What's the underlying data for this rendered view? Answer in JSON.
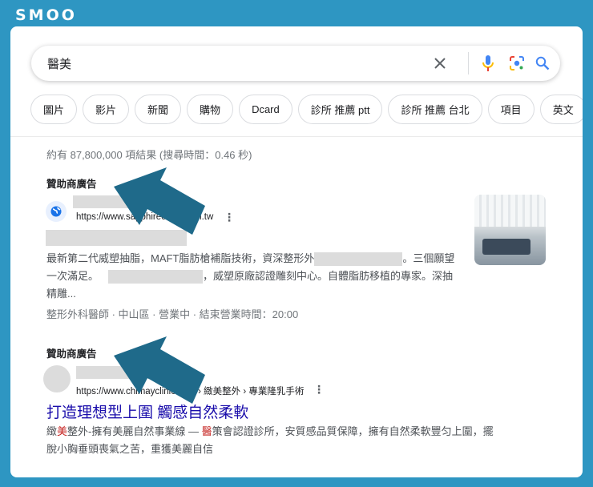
{
  "brand": "SMOO",
  "search": {
    "query": "醫美"
  },
  "chips": [
    "圖片",
    "影片",
    "新聞",
    "購物",
    "Dcard",
    "診所 推薦 ptt",
    "診所 推薦 台北",
    "項目",
    "英文"
  ],
  "stats": "約有 87,800,000 項結果 (搜尋時間：0.46 秒)",
  "results": [
    {
      "ad_label": "贊助商廣告",
      "url": "https://www.sapphireclinic.com.tw",
      "snippet_1": "最新第二代威塑抽脂，MAFT脂肪槍補脂技術，資深整形外",
      "snippet_2": "。三個願望一次滿足。",
      "snippet_3": "，威塑原廠認證雕刻中心。自體脂肪移植的專家。深抽精雕...",
      "meta": "整形外科醫師 · 中山區 · 營業中 · 結束營業時間：20:00"
    },
    {
      "ad_label": "贊助商廣告",
      "url": "https://www.chimayclinic.com › 緻美整外 › 專業隆乳手術",
      "title": "打造理想型上圍 觸感自然柔軟",
      "snippet_a": "緻",
      "snippet_hl1": "美",
      "snippet_b": "整外-擁有美麗自然事業線 — ",
      "snippet_hl2": "醫",
      "snippet_c": "策會認證診所，安質感品質保障，擁有自然柔軟豐匀上圍，擺脫小胸垂頭喪氣之苦，重獲美麗自信"
    }
  ],
  "colors": {
    "frame": "#2e96c2",
    "arrow": "#1f6a8a",
    "link": "#1a0dab"
  }
}
